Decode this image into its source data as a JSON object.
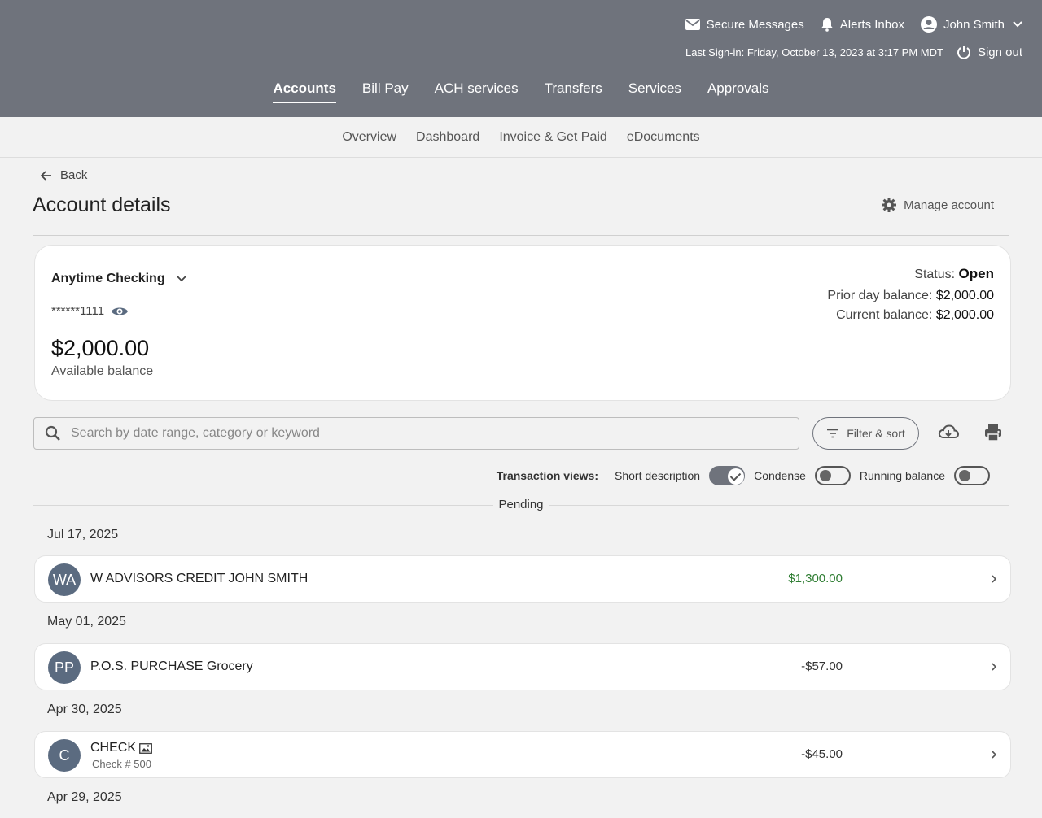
{
  "header": {
    "secure_messages": "Secure Messages",
    "alerts_inbox": "Alerts Inbox",
    "user_name": "John Smith",
    "last_signin": "Last Sign-in: Friday, October 13, 2023 at 3:17 PM MDT",
    "sign_out": "Sign out"
  },
  "main_nav": [
    "Accounts",
    "Bill Pay",
    "ACH services",
    "Transfers",
    "Services",
    "Approvals"
  ],
  "sub_nav": [
    "Overview",
    "Dashboard",
    "Invoice & Get Paid",
    "eDocuments"
  ],
  "page": {
    "back_label": "Back",
    "title": "Account details",
    "manage_label": "Manage account"
  },
  "account": {
    "name": "Anytime Checking",
    "number": "******1111",
    "available_balance": "$2,000.00",
    "available_label": "Available balance",
    "status_label": "Status:",
    "status_value": "Open",
    "prior_label": "Prior day balance:",
    "prior_value": "$2,000.00",
    "current_label": "Current balance:",
    "current_value": "$2,000.00"
  },
  "search": {
    "placeholder": "Search by date range, category or keyword"
  },
  "filter_label": "Filter & sort",
  "views": {
    "label": "Transaction views:",
    "short_description": "Short description",
    "condense": "Condense",
    "running_balance": "Running balance",
    "short_description_on": true,
    "condense_on": false,
    "running_balance_on": false
  },
  "pending_label": "Pending",
  "transactions": [
    {
      "date": "Jul 17, 2025",
      "initials": "WA",
      "description": "W ADVISORS CREDIT JOHN SMITH",
      "amount": "$1,300.00",
      "positive": true
    },
    {
      "date": "May 01, 2025",
      "initials": "PP",
      "description": "P.O.S. PURCHASE Grocery",
      "amount": "-$57.00",
      "positive": false
    },
    {
      "date": "Apr 30, 2025",
      "initials": "C",
      "description": "CHECK",
      "sub": "Check # 500",
      "amount": "-$45.00",
      "positive": false
    },
    {
      "date": "Apr 29, 2025"
    }
  ],
  "colors": {
    "header_bg": "#6f737c",
    "positive_amount": "#2e7d32",
    "avatar_bg": "#5b6b80"
  }
}
